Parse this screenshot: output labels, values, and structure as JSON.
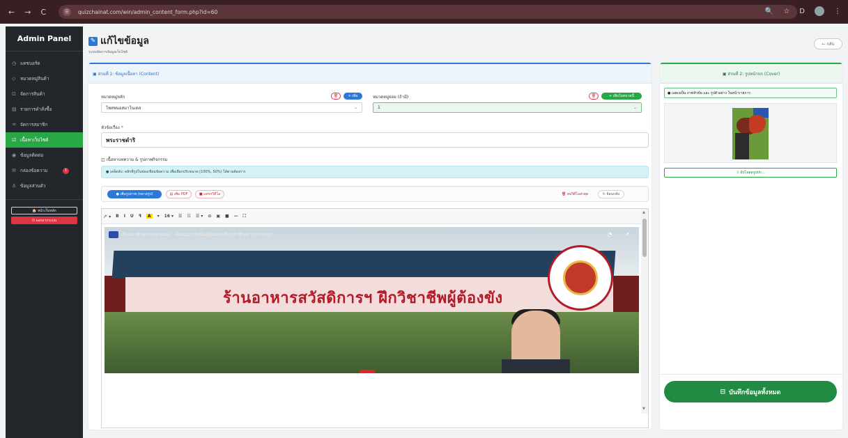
{
  "browser": {
    "url": "quizchainat.com/win/admin_content_form.php?id=60",
    "nav_back": "←",
    "nav_forward": "→",
    "reload": "C",
    "site_icon": "☰",
    "zoom_icon": "🔍",
    "star_icon": "☆",
    "ext_icon": "D",
    "menu_icon": "⋮"
  },
  "sidebar": {
    "brand": "Admin Panel",
    "items": [
      {
        "icon": "◷",
        "label": "แดชบอร์ด"
      },
      {
        "icon": "◇",
        "label": "หมวดหมู่สินค้า"
      },
      {
        "icon": "⊡",
        "label": "จัดการสินค้า"
      },
      {
        "icon": "▤",
        "label": "รายการคำสั่งซื้อ"
      },
      {
        "icon": "♒",
        "label": "จัดการสมาชิก"
      },
      {
        "icon": "☑",
        "label": "เนื้อหาเว็บไซต์"
      },
      {
        "icon": "◉",
        "label": "ข้อมูลติดต่อ"
      },
      {
        "icon": "✉",
        "label": "กล่องข้อความ",
        "badge": "1"
      },
      {
        "icon": "♙",
        "label": "ข้อมูลส่วนตัว"
      }
    ],
    "home_button": "🏠 หน้าเว็บหลัก",
    "logout_button": "⏻ ออกจากระบบ"
  },
  "header": {
    "title": "แก้ไขข้อมูล",
    "subtitle": "ระบบจัดการข้อมูลเว็บไซต์",
    "back_button": "← กลับ"
  },
  "content_card": {
    "title": "▣ ส่วนที่ 1: ข้อมูลเนื้อหา (Content)",
    "main_category_label": "หมวดหมู่หลัก",
    "main_category_value": "โพสพนอสมาโนเดล",
    "main_delete": "🗑",
    "main_add": "+ เพิ่ม",
    "sub_category_label": "หมวดหมู่ย่อย (ถ้ามี)",
    "sub_category_value": "1",
    "sub_delete": "🗑",
    "sub_add": "+ เพิ่มในหมวดนี้",
    "caret": "⌄",
    "title_label": "หัวข้อเรื่อง",
    "required_mark": "*",
    "title_value": "พระราชดำริ",
    "section_label": "◫ เนื้อหาบทความ & รูปภาพกิจกรรม",
    "info_text": "● เคล็ดลับ: คลิกที่รูปในช่องเขียนข้อความ เพื่อเลือกปรับขนาด (100%, 50%) ได้ตามต้องการ",
    "btn_add_images": "● เพิ่มรูปภาพ (หลายรูป)",
    "btn_add_pdf": "▤ เพิ่ม PDF",
    "btn_add_video": "■ แทรกวิดีโอ",
    "btn_clear": "🗑 ลบวิดีโอล่าสุด",
    "btn_undo": "↻ ย้อนกลับ",
    "editor_tools": [
      "⁄⸍ ▾",
      "B",
      "I",
      "U",
      "ꟻ",
      "16 ▾",
      "☰",
      "☷",
      "☰ ▾",
      "⊘",
      "▣",
      "■",
      "—",
      "⛶"
    ],
    "highlight_tool": "A",
    "highlight_caret": "▾",
    "video_title": "เรือนจำชั่วคราวเขาพลอง - ขั้นตอนการเยี่ยมผู้ต้องขังเรือนจำชั่วคราวเขาพลอง",
    "video_clock_icon": "◔",
    "video_share_icon": "↗",
    "sign_text": "ร้านอาหารสวัสดิการฯ ฝึกวิชาชีพผู้ต้องขัง",
    "scroll_up": "▲",
    "scroll_down": "▼"
  },
  "cover_card": {
    "title": "▣ ส่วนที่ 2: รูปหน้าปก (Cover)",
    "note": "● แสดงเป็น ภาพหัวข้อ และ รูปตัวอย่าง ในหน้ารายการ",
    "upload_button": "⇧ อัปโหลดรูปปก...",
    "save_button": "บันทึกข้อมูลทั้งหมด",
    "save_icon": "⊟"
  },
  "colors": {
    "primary": "#2b78d8",
    "success": "#28a745",
    "danger": "#dc3545",
    "sidebar_bg": "#23272b"
  }
}
